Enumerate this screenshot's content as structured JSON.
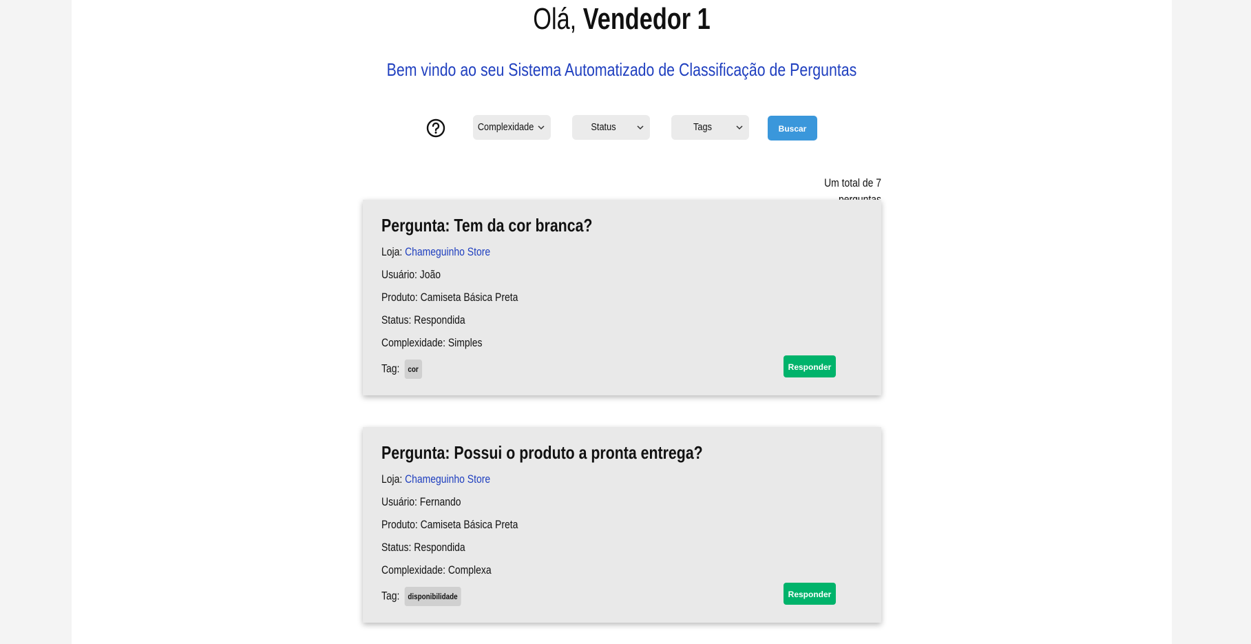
{
  "header": {
    "greeting_prefix": "Olá,",
    "vendor_name": "Vendedor 1",
    "subtitle": "Bem vindo ao seu Sistema Automatizado de Classificação de Perguntas"
  },
  "filters": {
    "help_icon": "question-circle-icon",
    "complexidade_label": "Complexidade",
    "status_label": "Status",
    "tags_label": "Tags",
    "search_label": "Buscar"
  },
  "summary": {
    "total_text": "Um total de 7 perguntas"
  },
  "labels": {
    "loja": "Loja: ",
    "usuario": "Usuário: ",
    "produto": "Produto: ",
    "status": "Status: ",
    "complexidade": "Complexidade: ",
    "tag": "Tag: ",
    "responder": "Responder"
  },
  "questions": [
    {
      "title": "Pergunta: Tem da cor branca?",
      "loja": "Chameguinho Store",
      "usuario": "João",
      "produto": "Camiseta Básica Preta",
      "status": "Respondida",
      "complexidade": "Simples",
      "tag": "cor"
    },
    {
      "title": "Pergunta: Possui o produto a pronta entrega?",
      "loja": "Chameguinho Store",
      "usuario": "Fernando",
      "produto": "Camiseta Básica Preta",
      "status": "Respondida",
      "complexidade": "Complexa",
      "tag": "disponibilidade"
    }
  ],
  "colors": {
    "link": "#1f3fbf",
    "search_button": "#3a97db",
    "reply_button": "#00b36b",
    "card_bg": "#e9e9e9",
    "tag_bg": "#d0d0d0"
  }
}
